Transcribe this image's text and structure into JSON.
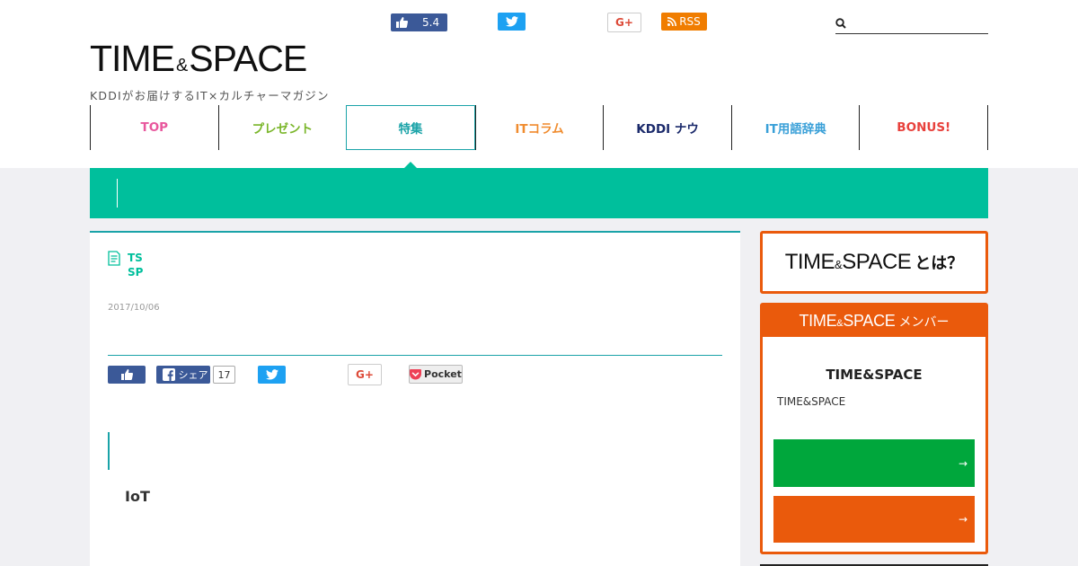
{
  "header": {
    "logo": {
      "title_left": "TIME",
      "amp": "&",
      "title_right": "SPACE",
      "tagline": "KDDIがお届けするIT×カルチャーマガジン"
    },
    "social": {
      "like_count": "5.4",
      "gplus_label": "G+",
      "rss_label": "RSS"
    },
    "search": {
      "value": "",
      "placeholder": ""
    }
  },
  "nav": [
    {
      "label": "TOP",
      "color": "#e8579d"
    },
    {
      "label": "プレゼント",
      "color": "#7ab62a"
    },
    {
      "label": "特集",
      "color": "#1aa3a8",
      "active": true
    },
    {
      "label": "ITコラム",
      "color": "#f08c2f"
    },
    {
      "label": "KDDI ナウ",
      "color": "#1b2a6b"
    },
    {
      "label": "IT用語辞典",
      "color": "#3aa0d8"
    },
    {
      "label": "BONUS!",
      "color": "#e8413c"
    }
  ],
  "article": {
    "author_line1": "TS",
    "author_line2": "SP",
    "date": "2017/10/06",
    "share": {
      "fb_share_label": "シェア",
      "fb_share_count": "17",
      "gplus_label": "G+",
      "pocket_label": "Pocket"
    },
    "heading": "IoT"
  },
  "sidebar": {
    "about": {
      "title_left": "TIME",
      "amp": "&",
      "title_right": "SPACE",
      "suffix": "とは？"
    },
    "member": {
      "title_left": "TIME",
      "amp": "&",
      "title_right": "SPACE",
      "suffix": "メンバー",
      "name": "TIME&SPACE",
      "desc": "TIME&SPACE",
      "arrow1": "→",
      "arrow2": "→"
    }
  },
  "colors": {
    "accent": "#00bf9c",
    "teal_line": "#1aa3a8",
    "orange": "#ea5a0c",
    "green": "#00a73c",
    "facebook": "#3b5998",
    "twitter": "#1da1f2",
    "rss": "#f07d00"
  }
}
